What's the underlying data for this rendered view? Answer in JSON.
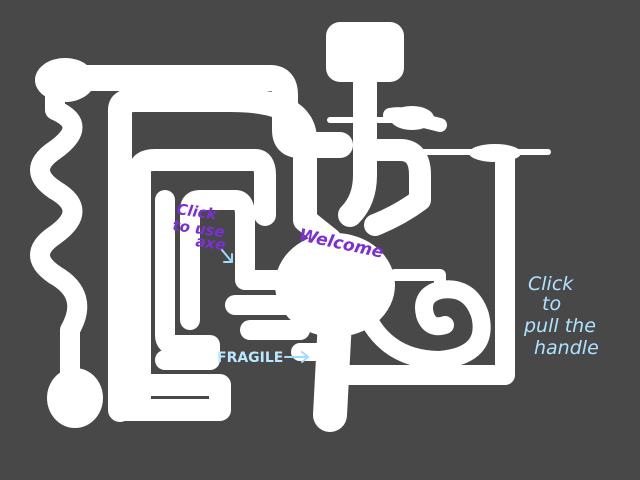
{
  "scene": {
    "background_color": "#484848",
    "tunnel_color": "#ffffff"
  },
  "labels": {
    "axe_line1": "Click",
    "axe_line2": "to use",
    "axe_line3": "axe",
    "welcome": "Welcome",
    "fragile": "FRAGILE",
    "handle_line1": "Click",
    "handle_line2": "to",
    "handle_line3": "pull the",
    "handle_line4": "handle"
  },
  "colors": {
    "purple_text": "#7b2fd6",
    "blue_text": "#aee3ff"
  }
}
